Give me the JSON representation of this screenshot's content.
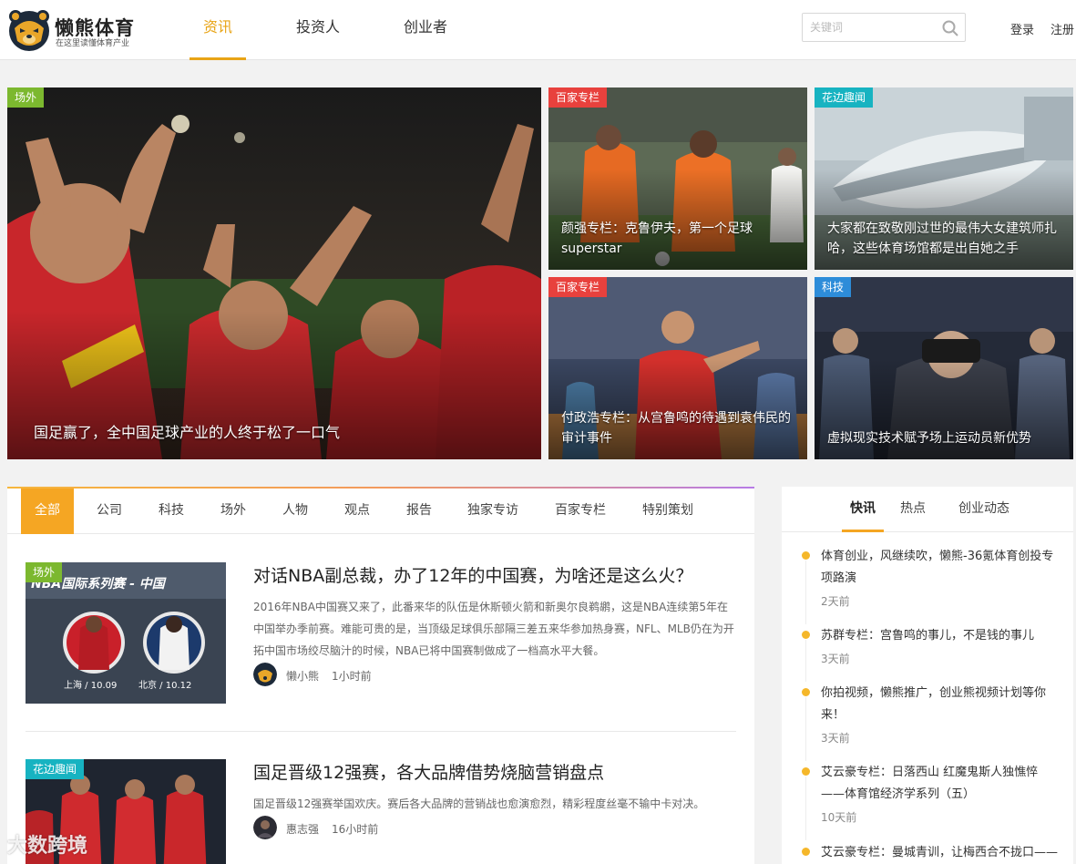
{
  "header": {
    "logo": {
      "title": "懒熊体育",
      "subtitle": "在这里读懂体育产业"
    },
    "nav": [
      {
        "label": "资讯",
        "active": true
      },
      {
        "label": "投资人",
        "active": false
      },
      {
        "label": "创业者",
        "active": false
      }
    ],
    "search": {
      "placeholder": "关键词"
    },
    "login": "登录",
    "register": "注册"
  },
  "hero": {
    "main": {
      "tag": "场外",
      "tag_color": "#7cb82f",
      "title": "国足赢了，全中国足球产业的人终于松了一口气"
    },
    "tiles": [
      {
        "tag": "百家专栏",
        "tag_color": "#e8413d",
        "title": "颜强专栏：克鲁伊夫，第一个足球superstar"
      },
      {
        "tag": "花边趣闻",
        "tag_color": "#17b3c1",
        "title": "大家都在致敬刚过世的最伟大女建筑师扎哈，这些体育场馆都是出自她之手"
      },
      {
        "tag": "百家专栏",
        "tag_color": "#e8413d",
        "title": "付政浩专栏：从宫鲁鸣的待遇到袁伟民的审计事件"
      },
      {
        "tag": "科技",
        "tag_color": "#2d8cd9",
        "title": "虚拟现实技术赋予场上运动员新优势"
      }
    ]
  },
  "categories": {
    "tabs": [
      "全部",
      "公司",
      "科技",
      "场外",
      "人物",
      "观点",
      "报告",
      "独家专访",
      "百家专栏",
      "特别策划"
    ],
    "active_index": 0
  },
  "articles": [
    {
      "tag": "场外",
      "tag_color": "#7cb82f",
      "thumb_caption": "NBA国际系列赛 - 中国",
      "thumb_left_city": "上海 / 10.09",
      "thumb_right_city": "北京 / 10.12",
      "title": "对话NBA副总裁，办了12年的中国赛，为啥还是这么火？",
      "summary": "2016年NBA中国赛又来了，此番来华的队伍是休斯顿火箭和新奥尔良鹈鹕，这是NBA连续第5年在中国举办季前赛。难能可贵的是，当顶级足球俱乐部隔三差五来华参加热身赛，NFL、MLB仍在为开拓中国市场绞尽脑汁的时候，NBA已将中国赛制做成了一档高水平大餐。",
      "author": "懒小熊",
      "time": "1小时前"
    },
    {
      "tag": "花边趣闻",
      "tag_color": "#17b3c1",
      "title": "国足晋级12强赛，各大品牌借势烧脑营销盘点",
      "summary": "国足晋级12强赛举国欢庆。赛后各大品牌的营销战也愈演愈烈，精彩程度丝毫不输中卡对决。",
      "author": "惠志强",
      "time": "16小时前"
    }
  ],
  "sidebar": {
    "tabs": [
      "快讯",
      "热点",
      "创业动态"
    ],
    "active_index": 0,
    "news": [
      {
        "text": "体育创业，风继续吹，懒熊-36氪体育创投专项路演",
        "time": "2天前"
      },
      {
        "text": "苏群专栏：宫鲁鸣的事儿，不是钱的事儿",
        "time": "3天前"
      },
      {
        "text": "你拍视频，懒熊推广，创业熊视频计划等你来！",
        "time": "3天前"
      },
      {
        "text": "艾云豪专栏：日落西山 红魔鬼斯人独憔悴——体育馆经济学系列（五）",
        "time": "10天前"
      },
      {
        "text": "艾云豪专栏：曼城青训，让梅西合不拢口——",
        "time": ""
      }
    ]
  },
  "watermark": "大数跨境",
  "colors": {
    "accent": "#f5a623",
    "nav_active": "#e8a416"
  }
}
